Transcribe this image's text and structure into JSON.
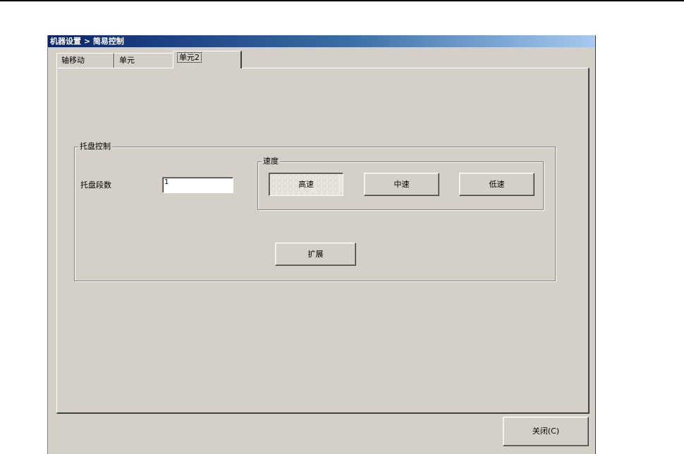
{
  "window": {
    "title": "机器设置 > 简易控制"
  },
  "tabs": [
    {
      "label": "轴移动",
      "selected": false
    },
    {
      "label": "单元",
      "selected": false
    },
    {
      "label": "单元2",
      "selected": true
    }
  ],
  "tray_group": {
    "title": "托盘控制",
    "tray_count_label": "托盘段数",
    "tray_count_value": "1",
    "expand_label": "扩展"
  },
  "speed_group": {
    "title": "速度",
    "high_label": "高速",
    "mid_label": "中速",
    "low_label": "低速",
    "selected": "高速"
  },
  "footer": {
    "close_label": "关闭(C)"
  },
  "colors": {
    "dialog_face": "#d4d0c8",
    "title_gradient_start": "#0a246a",
    "title_gradient_end": "#a6caf0"
  }
}
